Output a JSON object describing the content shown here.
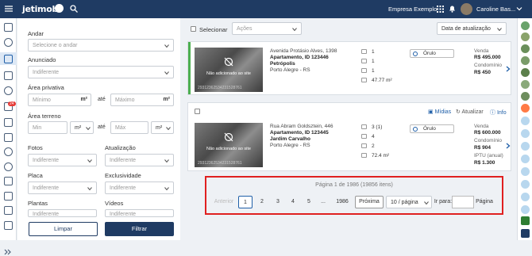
{
  "topbar": {
    "logo_text": "jetimob",
    "company": "Empresa Exemplo",
    "user_name": "Caroline Bas..."
  },
  "filters": {
    "andar_label": "Andar",
    "andar_placeholder": "Selecione o andar",
    "anunciado_label": "Anunciado",
    "anunciado_value": "Indiferente",
    "area_privativa_label": "Área privativa",
    "area_privativa_min": "Mínimo",
    "area_privativa_max": "Máximo",
    "unit_m2": "m²",
    "ate": "até",
    "area_terreno_label": "Área terreno",
    "area_terreno_min": "Min",
    "area_terreno_max": "Máx",
    "fotos_label": "Fotos",
    "fotos_value": "Indiferente",
    "atualizacao_label": "Atualização",
    "atualizacao_value": "Indiferente",
    "placa_label": "Placa",
    "placa_value": "Indiferente",
    "exclusividade_label": "Exclusividade",
    "exclusividade_value": "Indiferente",
    "plantas_label": "Plantas",
    "plantas_value": "Indiferente",
    "videos_label": "Vídeos",
    "videos_value": "Indiferente",
    "limpar": "Limpar",
    "filtrar": "Filtrar"
  },
  "badge": "24",
  "list": {
    "selecionar": "Selecionar",
    "acoes": "Ações",
    "sort": "Data de atualização",
    "photo_text": "Não adicionado ao site",
    "cards": [
      {
        "address": "Avenida Protásio Alves, 1398",
        "title1": "Apartamento, ID 123446",
        "title2": "Petrópolis",
        "city": "Porto Alegre - RS",
        "photo_id": "29312362534231528761",
        "a1": "1",
        "a2": "1",
        "a3": "1",
        "a4": "47.77 m²",
        "owner": "Órulo",
        "l1": "Venda",
        "v1": "R$ 495.000",
        "l2": "Condomínio",
        "v2": "R$ 450",
        "l3": "",
        "v3": ""
      },
      {
        "address": "Rua Abram Goldsztein, 446",
        "title1": "Apartamento, ID 123445",
        "title2": "Jardim Carvalho",
        "city": "Porto Alegre - RS",
        "photo_id": "29312362534231528761",
        "a1": "3 (1)",
        "a2": "4",
        "a3": "2",
        "a4": "72.4 m²",
        "owner": "Órulo",
        "l1": "Venda",
        "v1": "R$ 600.000",
        "l2": "Condomínio",
        "v2": "R$ 904",
        "l3": "IPTU (anual)",
        "v3": "R$ 1.300",
        "midias": "Mídias",
        "atualizar": "Atualizar",
        "info": "Info"
      }
    ]
  },
  "pagination": {
    "info": "Página 1 de 1986 (19856 itens)",
    "anterior": "Anterior",
    "pages": [
      "1",
      "2",
      "3",
      "4",
      "5"
    ],
    "ellipsis": "...",
    "last": "1986",
    "proxima": "Próxima",
    "per_page": "10 / página",
    "ir_para": "Ir para:",
    "pagina": "Página"
  }
}
